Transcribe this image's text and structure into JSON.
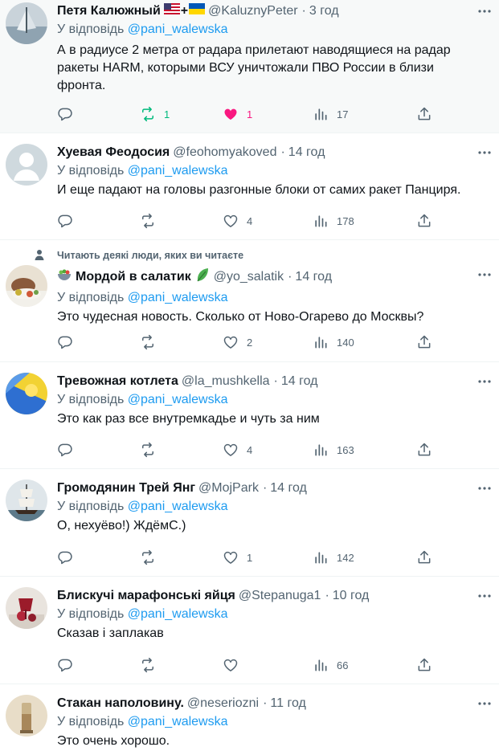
{
  "tweets": [
    {
      "name": "Петя Калюжный",
      "handle": "@KaluznyPeter",
      "sep": "·",
      "time": "3 год",
      "reply_prefix": "У відповідь",
      "reply_mention": "@pani_walewska",
      "text": "А в радиусе 2 метра от радара прилетают наводящиеся на радар ракеты HARM, которыми ВСУ уничтожали ПВО России в близи фронта.",
      "retweets": "1",
      "likes": "1",
      "views": "17"
    },
    {
      "name": "Хуевая Феодосия",
      "handle": "@feohomyakoved",
      "sep": "·",
      "time": "14 год",
      "reply_prefix": "У відповідь",
      "reply_mention": "@pani_walewska",
      "text": "И еще падают на головы разгонные блоки от самих ракет Панциря.",
      "retweets": "",
      "likes": "4",
      "views": "178"
    },
    {
      "social_context": "Читають деякі люди, яких ви читаєте",
      "name": "Мордой в салатик",
      "handle": "@yo_salatik",
      "sep": "·",
      "time": "14 год",
      "reply_prefix": "У відповідь",
      "reply_mention": "@pani_walewska",
      "text": "Это чудесная новость. Сколько от Ново-Огарево до Москвы?",
      "retweets": "",
      "likes": "2",
      "views": "140"
    },
    {
      "name": "Тревожная котлета",
      "handle": "@la_mushkella",
      "sep": "·",
      "time": "14 год",
      "reply_prefix": "У відповідь",
      "reply_mention": "@pani_walewska",
      "text": "Это как раз все внутремкадье и чуть за ним",
      "retweets": "",
      "likes": "4",
      "views": "163"
    },
    {
      "name": "Громодянин Трей Янг",
      "handle": "@MojPark",
      "sep": "·",
      "time": "14 год",
      "reply_prefix": "У відповідь",
      "reply_mention": "@pani_walewska",
      "text": "О, нехуёво!) ЖдёмС.)",
      "retweets": "",
      "likes": "1",
      "views": "142"
    },
    {
      "name": "Блискучі марафонські яйця",
      "handle": "@Stepanuga1",
      "sep": "·",
      "time": "10 год",
      "reply_prefix": "У відповідь",
      "reply_mention": "@pani_walewska",
      "text": "Сказав і заплакав",
      "retweets": "",
      "likes": "",
      "views": "66"
    },
    {
      "name": "Стакан наполовину.",
      "handle": "@neseriozni",
      "sep": "·",
      "time": "11 год",
      "reply_prefix": "У відповідь",
      "reply_mention": "@pani_walewska",
      "text": "Это очень хорошо.",
      "retweets": "",
      "likes": "",
      "views": ""
    }
  ],
  "colors": {
    "secondary": "#536471",
    "accent": "#1d9bf0",
    "like_active": "#f91880",
    "retweet_active": "#00ba7c"
  },
  "icons": [
    "reply-icon",
    "retweet-icon",
    "like-icon",
    "views-icon",
    "share-icon",
    "more-icon"
  ]
}
